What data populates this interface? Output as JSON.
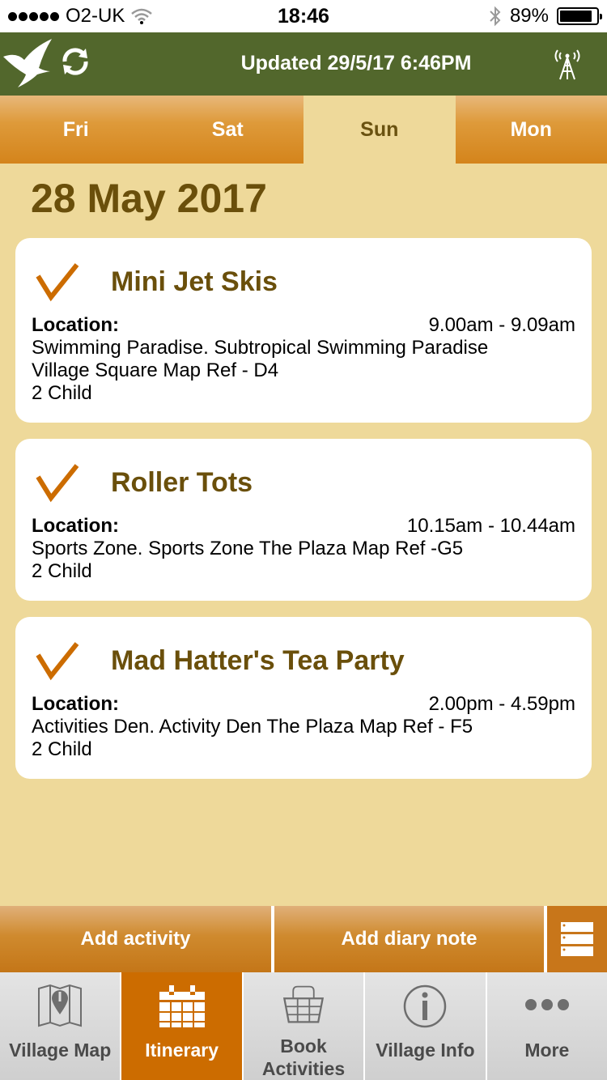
{
  "status_bar": {
    "carrier": "O2-UK",
    "time": "18:46",
    "battery_percent": "89%",
    "battery_level": 0.89,
    "signal_bars": 5,
    "icons": [
      "signal-dots-icon",
      "wifi-icon",
      "bluetooth-icon",
      "battery-icon"
    ]
  },
  "header": {
    "updated_text": "Updated 29/5/17 6:46PM",
    "icons": [
      "bird-logo-icon",
      "sync-icon",
      "antenna-icon"
    ]
  },
  "day_tabs": [
    {
      "label": "Fri",
      "active": false
    },
    {
      "label": "Sat",
      "active": false
    },
    {
      "label": "Sun",
      "active": true
    },
    {
      "label": "Mon",
      "active": false
    }
  ],
  "date_heading": "28 May 2017",
  "activities": [
    {
      "title": "Mini Jet Skis",
      "location_label": "Location:",
      "time": "9.00am - 9.09am",
      "location_lines": [
        "Swimming Paradise. Subtropical Swimming Paradise",
        "Village Square Map Ref - D4"
      ],
      "attendees": "2 Child",
      "checked": true
    },
    {
      "title": "Roller Tots",
      "location_label": "Location:",
      "time": "10.15am - 10.44am",
      "location_lines": [
        "Sports Zone. Sports Zone The Plaza Map Ref -G5"
      ],
      "attendees": "2 Child",
      "checked": true
    },
    {
      "title": "Mad Hatter's Tea Party",
      "location_label": "Location:",
      "time": "2.00pm - 4.59pm",
      "location_lines": [
        "Activities Den. Activity Den The Plaza Map Ref - F5"
      ],
      "attendees": "2 Child",
      "checked": true
    }
  ],
  "actions": {
    "add_activity": "Add activity",
    "add_diary_note": "Add diary note",
    "list_icon": "list-icon"
  },
  "tab_bar": [
    {
      "label": "Village Map",
      "icon": "map-icon",
      "active": false
    },
    {
      "label": "Itinerary",
      "icon": "calendar-icon",
      "active": true
    },
    {
      "label": "Book\nActivities",
      "label_lines": [
        "Book",
        "Activities"
      ],
      "icon": "basket-icon",
      "active": false
    },
    {
      "label": "Village Info",
      "icon": "info-icon",
      "active": false
    },
    {
      "label": "More",
      "icon": "more-icon",
      "active": false
    }
  ],
  "colors": {
    "header_green": "#52672c",
    "background_tan": "#eed99a",
    "accent_orange": "#cc6c00",
    "title_brown": "#6a4f0b"
  }
}
